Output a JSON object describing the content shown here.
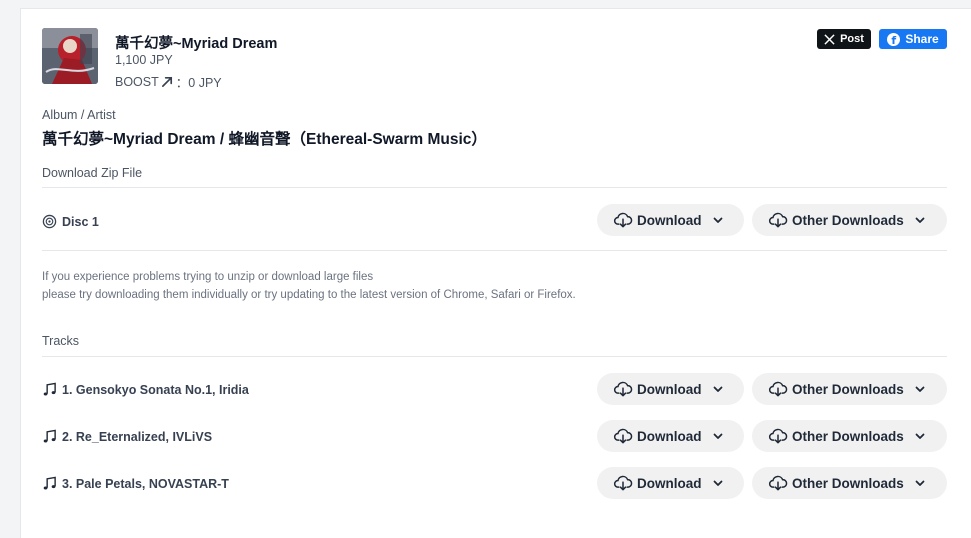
{
  "album": {
    "title": "萬千幻夢~Myriad Dream",
    "price": "1,100 JPY",
    "boost_label": "BOOST",
    "boost_value": "：0 JPY"
  },
  "share": {
    "x_label": "Post",
    "fb_label": "Share"
  },
  "album_artist": {
    "heading": "Album / Artist",
    "value": "萬千幻夢~Myriad Dream / 蜂幽音聲（Ethereal-Swarm Music）"
  },
  "zip": {
    "heading": "Download Zip File",
    "disc_label": "Disc 1",
    "download_label": "Download",
    "other_label": "Other Downloads"
  },
  "help": {
    "line1": "If you experience problems trying to unzip or download large files",
    "line2": "please try downloading them individually or try updating to the latest version of Chrome, Safari or Firefox."
  },
  "tracks": {
    "heading": "Tracks",
    "download_label": "Download",
    "other_label": "Other Downloads",
    "items": [
      {
        "label": "1. Gensokyo Sonata No.1, Iridia"
      },
      {
        "label": "2. Re_Eternalized, IVLiVS"
      },
      {
        "label": "3. Pale Petals, NOVASTAR-T"
      }
    ]
  },
  "colors": {
    "x_bg": "#0f1419",
    "fb_bg": "#1877f2",
    "pill_bg": "#f1f1f1"
  },
  "icons": [
    "boost-arrow-icon",
    "x-logo-icon",
    "facebook-icon",
    "disc-icon",
    "cloud-download-icon",
    "chevron-down-icon",
    "music-note-icon"
  ]
}
